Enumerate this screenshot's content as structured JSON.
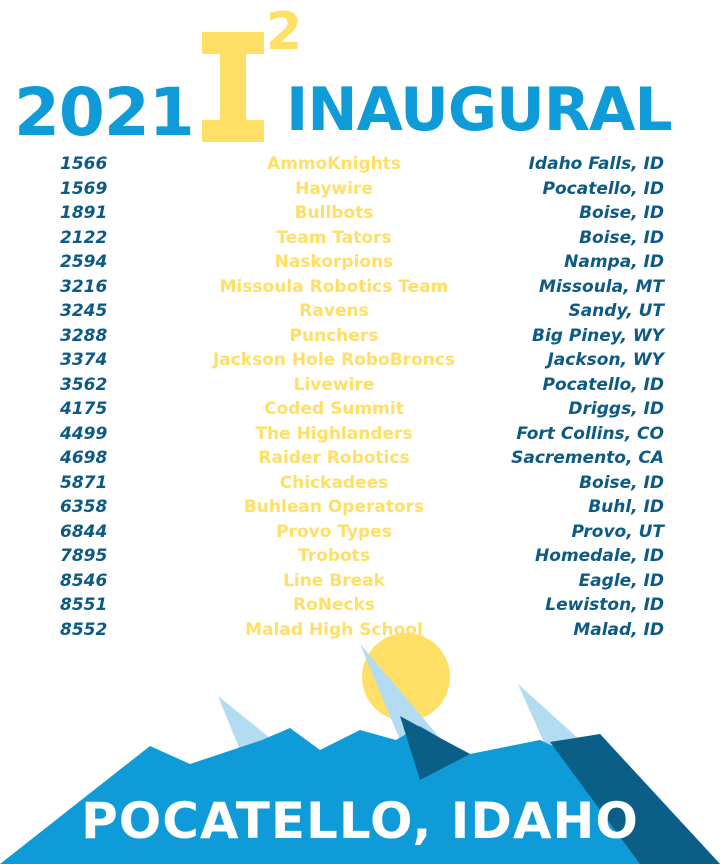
{
  "header": {
    "year": "2021",
    "letter": "I",
    "superscript": "2",
    "word": "INAUGURAL"
  },
  "teams": [
    {
      "number": "1566",
      "name": "AmmoKnights",
      "location": "Idaho Falls, ID"
    },
    {
      "number": "1569",
      "name": "Haywire",
      "location": "Pocatello, ID"
    },
    {
      "number": "1891",
      "name": "Bullbots",
      "location": "Boise, ID"
    },
    {
      "number": "2122",
      "name": "Team Tators",
      "location": "Boise, ID"
    },
    {
      "number": "2594",
      "name": "Naskorpions",
      "location": "Nampa, ID"
    },
    {
      "number": "3216",
      "name": "Missoula Robotics Team",
      "location": "Missoula, MT"
    },
    {
      "number": "3245",
      "name": "Ravens",
      "location": "Sandy, UT"
    },
    {
      "number": "3288",
      "name": "Punchers",
      "location": "Big Piney, WY"
    },
    {
      "number": "3374",
      "name": "Jackson Hole RoboBroncs",
      "location": "Jackson, WY"
    },
    {
      "number": "3562",
      "name": "Livewire",
      "location": "Pocatello, ID"
    },
    {
      "number": "4175",
      "name": "Coded Summit",
      "location": "Driggs, ID"
    },
    {
      "number": "4499",
      "name": "The Highlanders",
      "location": "Fort Collins, CO"
    },
    {
      "number": "4698",
      "name": "Raider Robotics",
      "location": "Sacremento, CA"
    },
    {
      "number": "5871",
      "name": "Chickadees",
      "location": "Boise, ID"
    },
    {
      "number": "6358",
      "name": "Buhlean Operators",
      "location": "Buhl, ID"
    },
    {
      "number": "6844",
      "name": "Provo Types",
      "location": "Provo, UT"
    },
    {
      "number": "7895",
      "name": "Trobots",
      "location": "Homedale, ID"
    },
    {
      "number": "8546",
      "name": "Line Break",
      "location": "Eagle, ID"
    },
    {
      "number": "8551",
      "name": "RoNecks",
      "location": "Lewiston, ID"
    },
    {
      "number": "8552",
      "name": "Malad High School",
      "location": "Malad, ID"
    }
  ],
  "footer": {
    "text": "POCATELLO, IDAHO"
  },
  "colors": {
    "blue": "#0f9bd8",
    "navy": "#0d5b85",
    "yellow": "#ffdf66",
    "light_blue": "#b3dcf2",
    "dark_teal": "#0b5f86"
  }
}
